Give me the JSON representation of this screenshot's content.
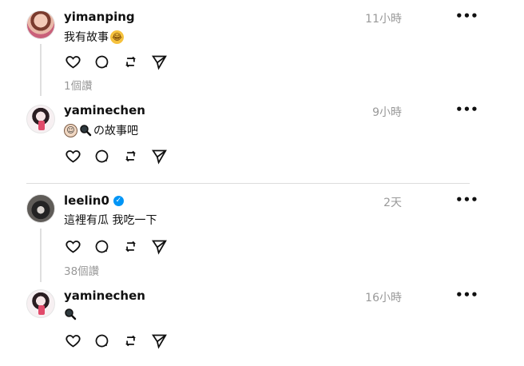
{
  "posts": [
    {
      "username": "yimanping",
      "time": "11小時",
      "text": "我有故事",
      "emojis": [
        "laughing-tears-emoji"
      ],
      "reply_count": "1個讚",
      "verified": false
    },
    {
      "username": "yaminechen",
      "time": "9小時",
      "text": "の故事吧",
      "emojis": [
        "face-emoji",
        "magnifying-glass-emoji"
      ],
      "verified": false
    },
    {
      "username": "leelin0",
      "time": "2天",
      "text": "這裡有瓜 我吃一下",
      "reply_count": "38個讚",
      "verified": true
    },
    {
      "username": "yaminechen",
      "time": "16小時",
      "text": "",
      "emojis": [
        "magnifying-glass-emoji"
      ],
      "verified": false
    }
  ],
  "icons": [
    "heart-icon",
    "comment-icon",
    "repost-icon",
    "share-icon",
    "more-icon"
  ],
  "colors": {
    "text": "#101010",
    "muted": "#999999",
    "verified": "#0095f6",
    "line": "#dfdfdf"
  }
}
